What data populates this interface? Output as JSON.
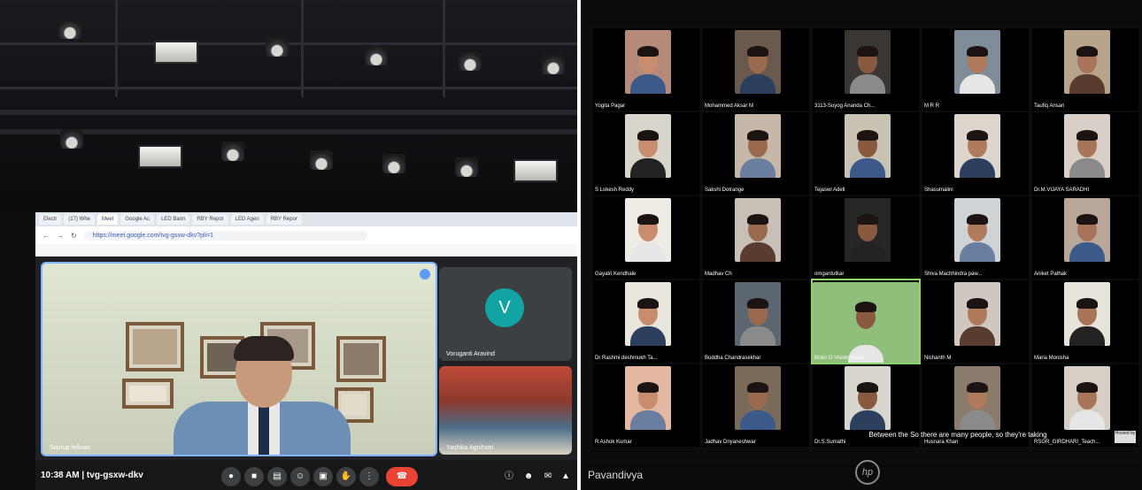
{
  "left_photo": {
    "browser": {
      "tabs": [
        "Electr",
        "(17) Whe",
        "Meet",
        "Google Ac",
        "LED Bann",
        "RBY Repor",
        "LED Agen",
        "RBY Repor"
      ],
      "url": "https://meet.google.com/tvg-gsxw-dkv?pli=1"
    },
    "meeting": {
      "main_speaker_label": "Startup fellows",
      "side_tiles": [
        {
          "name": "Voruganti Aravind",
          "avatar_letter": "V"
        },
        {
          "name": "Yashika Agnihotri"
        }
      ],
      "clock": "10:38 AM",
      "separator": "|",
      "meeting_code": "tvg-gsxw-dkv"
    }
  },
  "right_photo": {
    "participants": [
      "Yogita Pagar",
      "Mohammed Aksar M",
      "3113-Suyog Ananda Ch...",
      "M R R",
      "Taufiq Ansari",
      "S Lokesh Reddy",
      "Sakshi Dotrange",
      "Tejaswi Adell",
      "Shasumalini",
      "Dr.M.VIJAYA SARADHI",
      "Gayatri Kendhale",
      "Madhav Ch",
      "omgantutkar",
      "Shiva Machhindra paw...",
      "Aniket Pathak",
      "Dr Rashmi deshmukh Ta...",
      "Buddha Chandrasekhar",
      "Brain O Vision Vision",
      "Nishanth M",
      "Maria Monisha",
      "R Ashok Kumar",
      "Jadhav Dnyaneshwar",
      "Dr.S.Sumathi",
      "Husnara Khan",
      "RSGR_GIRDHARI_Teach..."
    ],
    "caption": "Between the So there are many people, so they're taking",
    "presenter_name": "Pavandivya",
    "laptop_logo": "hp",
    "badge_text": "Hosted by"
  }
}
